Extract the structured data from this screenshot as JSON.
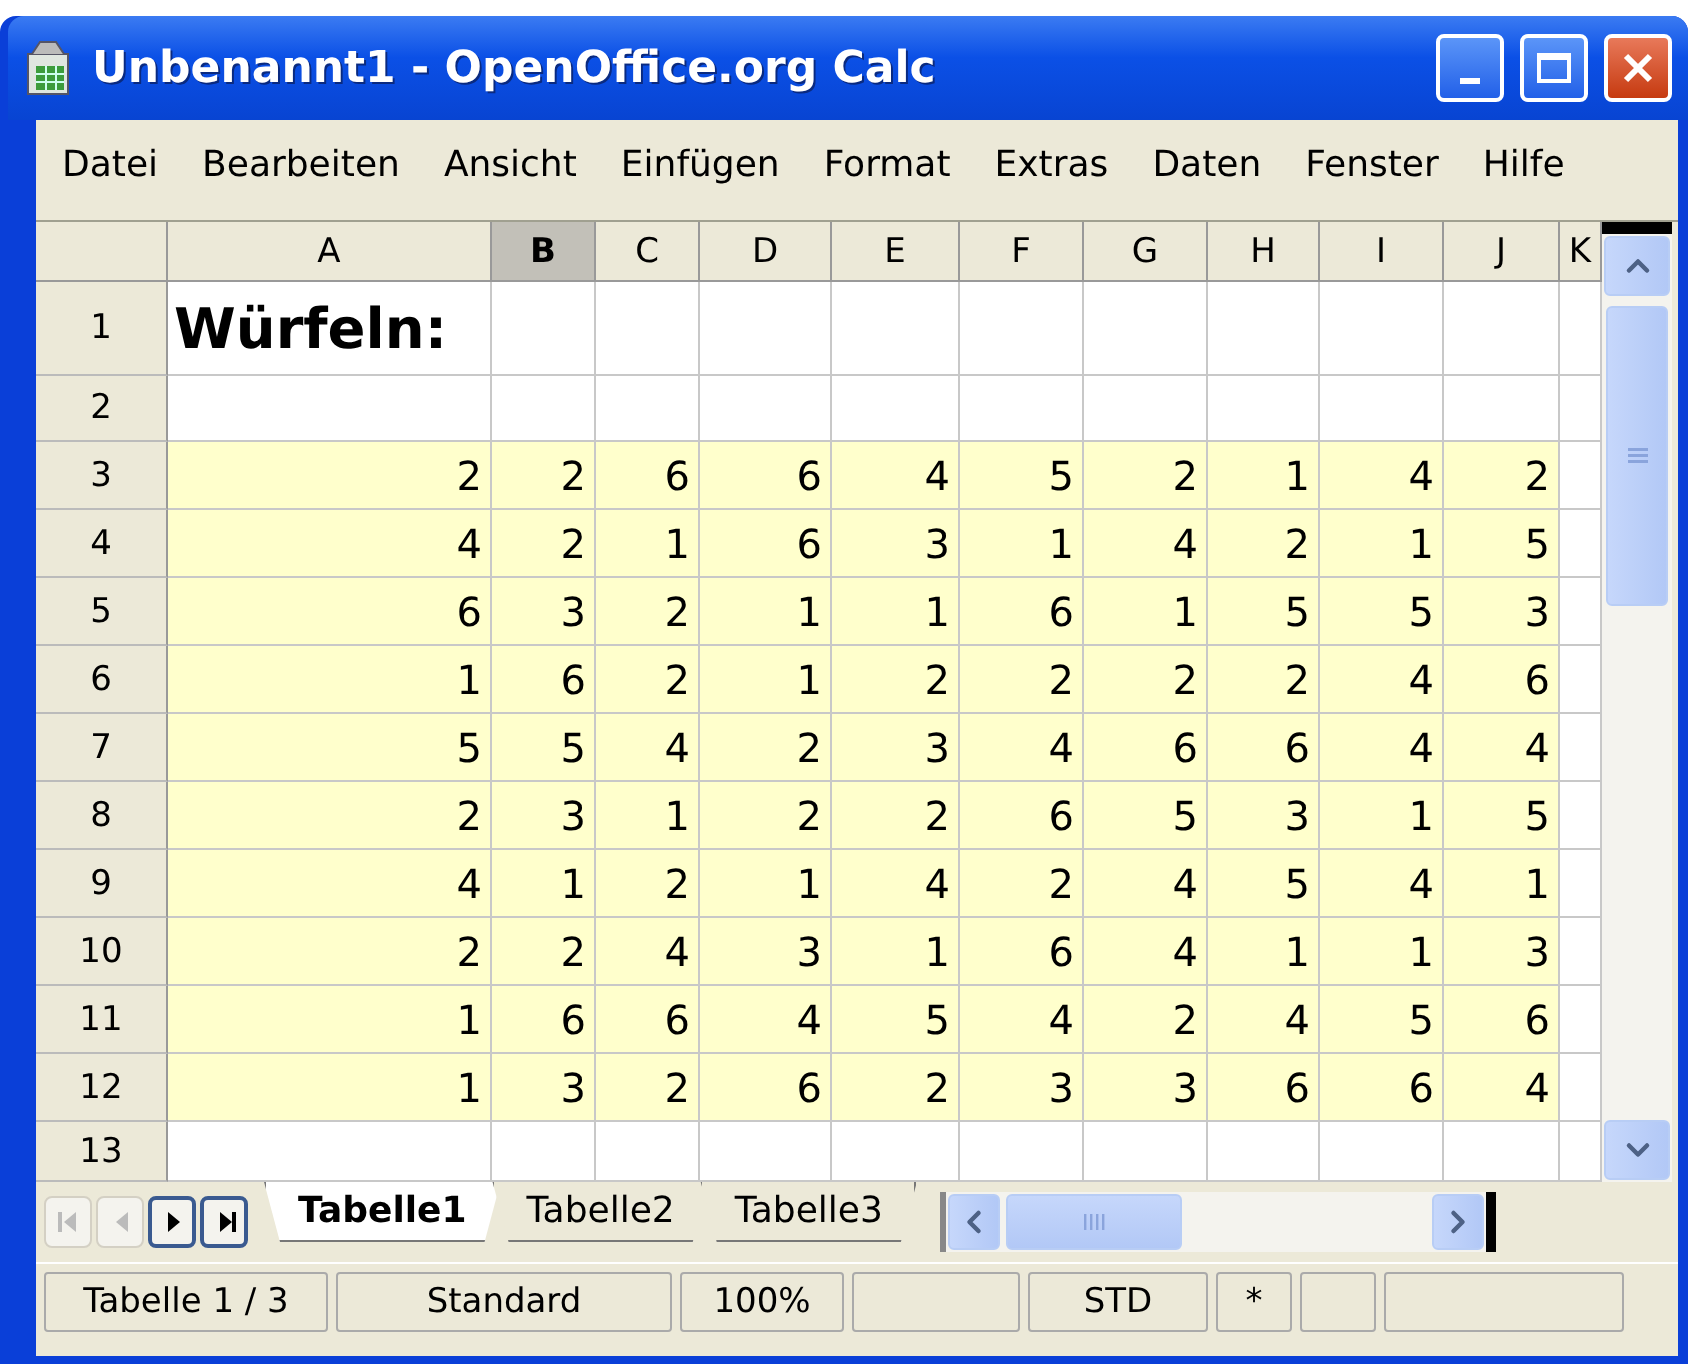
{
  "window": {
    "title": "Unbenannt1 - OpenOffice.org Calc"
  },
  "menu": [
    {
      "label": "Datei"
    },
    {
      "label": "Bearbeiten"
    },
    {
      "label": "Ansicht"
    },
    {
      "label": "Einfügen"
    },
    {
      "label": "Format"
    },
    {
      "label": "Extras"
    },
    {
      "label": "Daten"
    },
    {
      "label": "Fenster"
    },
    {
      "label": "Hilfe"
    }
  ],
  "table": {
    "columns": [
      {
        "label": "A",
        "selected": false
      },
      {
        "label": "B",
        "selected": true
      },
      {
        "label": "C",
        "selected": false
      },
      {
        "label": "D",
        "selected": false
      },
      {
        "label": "E",
        "selected": false
      },
      {
        "label": "F",
        "selected": false
      },
      {
        "label": "G",
        "selected": false
      },
      {
        "label": "H",
        "selected": false
      },
      {
        "label": "I",
        "selected": false
      },
      {
        "label": "J",
        "selected": false
      },
      {
        "label": "K",
        "selected": false
      }
    ],
    "rows": [
      {
        "header": "1",
        "highlighted": false,
        "title": "Würfeln:",
        "cells": []
      },
      {
        "header": "2",
        "highlighted": false,
        "cells": []
      },
      {
        "header": "3",
        "highlighted": true,
        "cells": [
          "2",
          "2",
          "6",
          "6",
          "4",
          "5",
          "2",
          "1",
          "4",
          "2"
        ]
      },
      {
        "header": "4",
        "highlighted": true,
        "cells": [
          "4",
          "2",
          "1",
          "6",
          "3",
          "1",
          "4",
          "2",
          "1",
          "5"
        ]
      },
      {
        "header": "5",
        "highlighted": true,
        "cells": [
          "6",
          "3",
          "2",
          "1",
          "1",
          "6",
          "1",
          "5",
          "5",
          "3"
        ]
      },
      {
        "header": "6",
        "highlighted": true,
        "cells": [
          "1",
          "6",
          "2",
          "1",
          "2",
          "2",
          "2",
          "2",
          "4",
          "6"
        ]
      },
      {
        "header": "7",
        "highlighted": true,
        "cells": [
          "5",
          "5",
          "4",
          "2",
          "3",
          "4",
          "6",
          "6",
          "4",
          "4"
        ]
      },
      {
        "header": "8",
        "highlighted": true,
        "cells": [
          "2",
          "3",
          "1",
          "2",
          "2",
          "6",
          "5",
          "3",
          "1",
          "5"
        ]
      },
      {
        "header": "9",
        "highlighted": true,
        "cells": [
          "4",
          "1",
          "2",
          "1",
          "4",
          "2",
          "4",
          "5",
          "4",
          "1"
        ]
      },
      {
        "header": "10",
        "highlighted": true,
        "cells": [
          "2",
          "2",
          "4",
          "3",
          "1",
          "6",
          "4",
          "1",
          "1",
          "3"
        ]
      },
      {
        "header": "11",
        "highlighted": true,
        "cells": [
          "1",
          "6",
          "6",
          "4",
          "5",
          "4",
          "2",
          "4",
          "5",
          "6"
        ]
      },
      {
        "header": "12",
        "highlighted": true,
        "cells": [
          "1",
          "3",
          "2",
          "6",
          "2",
          "3",
          "3",
          "6",
          "6",
          "4"
        ]
      },
      {
        "header": "13",
        "highlighted": false,
        "cells": []
      }
    ]
  },
  "sheet_nav": [
    {
      "kind": "first",
      "disabled": true
    },
    {
      "kind": "prev",
      "disabled": true
    },
    {
      "kind": "next",
      "disabled": false
    },
    {
      "kind": "last",
      "disabled": false
    }
  ],
  "sheet_tabs": [
    {
      "label": "Tabelle1",
      "selected": true
    },
    {
      "label": "Tabelle2",
      "selected": false
    },
    {
      "label": "Tabelle3",
      "selected": false
    }
  ],
  "status_bar": [
    {
      "kind": "text",
      "text": "Tabelle 1 / 3"
    },
    {
      "kind": "text",
      "text": "Standard"
    },
    {
      "kind": "text",
      "text": "100%"
    },
    {
      "kind": "blank"
    },
    {
      "kind": "text",
      "text": "STD"
    },
    {
      "kind": "text",
      "text": "*"
    },
    {
      "kind": "blank"
    },
    {
      "kind": "blank"
    }
  ]
}
